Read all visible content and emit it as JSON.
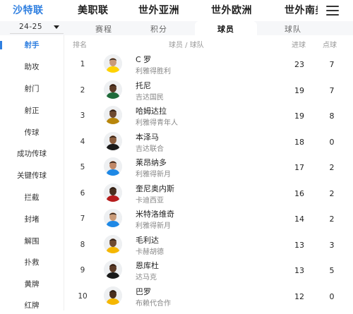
{
  "top_nav": {
    "leagues": [
      "沙特联",
      "美职联",
      "世外亚洲",
      "世外欧洲",
      "世外南美"
    ]
  },
  "sub_nav": {
    "season": "24-25",
    "tabs": [
      "赛程",
      "积分",
      "球员",
      "球队"
    ],
    "active_tab": "球员"
  },
  "sidebar": {
    "items": [
      "射手",
      "助攻",
      "射门",
      "射正",
      "传球",
      "成功传球",
      "关键传球",
      "拦截",
      "封堵",
      "解围",
      "扑救",
      "黄牌",
      "红牌"
    ],
    "active": "射手"
  },
  "table": {
    "headers": {
      "rank": "排名",
      "player": "球员 / 球队",
      "goals": "进球",
      "penalties": "点球"
    },
    "rows": [
      {
        "rank": "1",
        "name": "C 罗",
        "team": "利雅得胜利",
        "goals": "23",
        "penalties": "7"
      },
      {
        "rank": "2",
        "name": "托尼",
        "team": "吉达国民",
        "goals": "19",
        "penalties": "7"
      },
      {
        "rank": "3",
        "name": "哈姆达拉",
        "team": "利雅得青年人",
        "goals": "19",
        "penalties": "8"
      },
      {
        "rank": "4",
        "name": "本泽马",
        "team": "吉达联合",
        "goals": "18",
        "penalties": "0"
      },
      {
        "rank": "5",
        "name": "莱昂纳多",
        "team": "利雅得新月",
        "goals": "17",
        "penalties": "2"
      },
      {
        "rank": "6",
        "name": "奎尼奥内斯",
        "team": "卡迪西亚",
        "goals": "16",
        "penalties": "2"
      },
      {
        "rank": "7",
        "name": "米特洛维奇",
        "team": "利雅得新月",
        "goals": "14",
        "penalties": "2"
      },
      {
        "rank": "8",
        "name": "毛利达",
        "team": "卡赫胡德",
        "goals": "13",
        "penalties": "3"
      },
      {
        "rank": "9",
        "name": "恩库杜",
        "team": "达马克",
        "goals": "13",
        "penalties": "5"
      },
      {
        "rank": "10",
        "name": "巴罗",
        "team": "布赖代合作",
        "goals": "12",
        "penalties": "0"
      }
    ]
  },
  "colors": {
    "accent": "#2f7fe0",
    "jersey": [
      "#ffd200",
      "#1f6b3a",
      "#b8860b",
      "#1a1a1a",
      "#1e88e5",
      "#b71c1c",
      "#1e88e5",
      "#f5b700",
      "#1a1a1a",
      "#f5b700"
    ],
    "skin": [
      "#c99a78",
      "#5a3a26",
      "#6e4a30",
      "#8a5c3c",
      "#c08868",
      "#4a2f1e",
      "#c99a78",
      "#6e4a30",
      "#5a3a26",
      "#4a2f1e"
    ]
  }
}
